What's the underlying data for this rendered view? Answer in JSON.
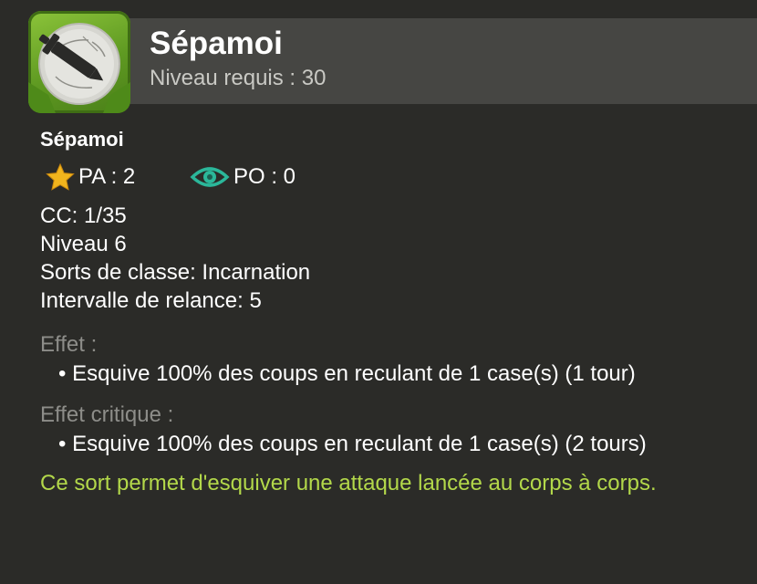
{
  "header": {
    "title": "Sépamoi",
    "subtitle": "Niveau requis : 30",
    "icon": "dodge-blade-spell-icon"
  },
  "spell": {
    "name": "Sépamoi",
    "pa_label": "PA : 2",
    "po_label": "PO : 0",
    "pa_icon": "star-icon",
    "po_icon": "eye-icon",
    "details": [
      "CC: 1/35",
      "Niveau 6",
      "Sorts de classe: Incarnation",
      "Intervalle de relance: 5"
    ]
  },
  "effects": {
    "label": "Effet :",
    "items": [
      "• Esquive 100% des coups en reculant de 1 case(s) (1 tour)"
    ]
  },
  "critical_effects": {
    "label": "Effet critique :",
    "items": [
      "• Esquive 100% des coups en reculant de 1 case(s) (2 tours)"
    ]
  },
  "description": "Ce sort permet d'esquiver une attaque lancée au corps à corps.",
  "colors": {
    "background": "#2b2b28",
    "header_band": "#464643",
    "label_gray": "#8d8d89",
    "description_green": "#b3d84a",
    "star_gold": "#f2b51d",
    "eye_teal": "#2bb79a",
    "icon_green": "#6fa82a"
  }
}
